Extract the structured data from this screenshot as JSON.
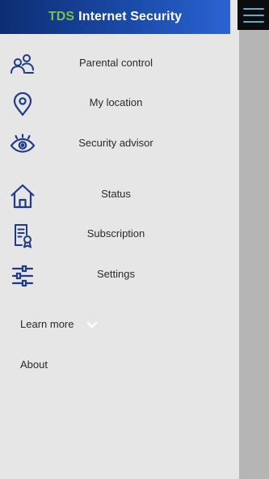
{
  "header": {
    "brand_mark": "TDS",
    "brand_text": "Internet Security"
  },
  "menu": {
    "items": [
      {
        "label": "Parental control",
        "icon": "parental-control-icon"
      },
      {
        "label": "My location",
        "icon": "location-pin-icon"
      },
      {
        "label": "Security advisor",
        "icon": "eye-icon"
      },
      {
        "label": "Status",
        "icon": "home-icon"
      },
      {
        "label": "Subscription",
        "icon": "subscription-certificate-icon"
      },
      {
        "label": "Settings",
        "icon": "sliders-icon"
      }
    ],
    "learn_more": "Learn more",
    "about": "About"
  },
  "colors": {
    "header_dark": "#0d2d72",
    "header_light": "#2a63d2",
    "brand_green": "#7cc04a",
    "icon_blue": "#1f3a8a",
    "hamburger": "#5aaed0",
    "drawer_bg": "#e6e6e6",
    "overlay_bg": "#b5b5b5"
  }
}
